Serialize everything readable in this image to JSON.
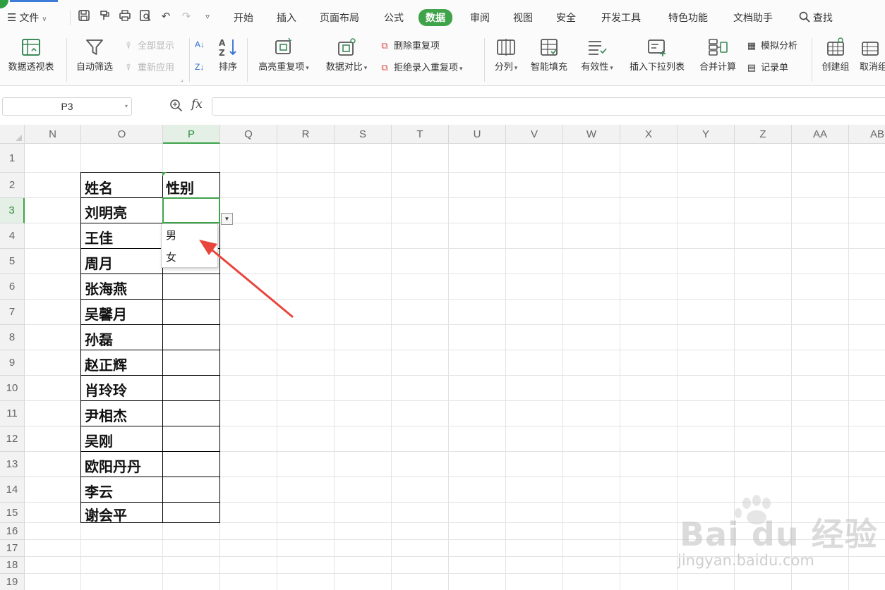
{
  "menubar": {
    "file_label": "文件",
    "tabs": [
      "开始",
      "插入",
      "页面布局",
      "公式",
      "数据",
      "审阅",
      "视图",
      "安全",
      "开发工具",
      "特色功能",
      "文档助手"
    ],
    "active_tab": "数据",
    "search_label": "查找",
    "accent_color": "#3fa34a"
  },
  "ribbon": {
    "pivot_label": "数据透视表",
    "autofilter_label": "自动筛选",
    "show_all_label": "全部显示",
    "reapply_label": "重新应用",
    "sort_label": "排序",
    "highlight_dup_label": "高亮重复项",
    "compare_label": "数据对比",
    "remove_dup_label": "删除重复项",
    "reject_dup_label": "拒绝录入重复项",
    "split_label": "分列",
    "smart_fill_label": "智能填充",
    "validity_label": "有效性",
    "insert_dropdown_label": "插入下拉列表",
    "consolidate_label": "合并计算",
    "simulate_label": "模拟分析",
    "record_label": "记录单",
    "group_label": "创建组",
    "ungroup_label": "取消组"
  },
  "formula_bar": {
    "name_box": "P3",
    "fx_label": "fx",
    "formula": ""
  },
  "sheet": {
    "columns": [
      "N",
      "O",
      "P",
      "Q",
      "R",
      "S",
      "T",
      "U",
      "V",
      "W",
      "X",
      "Y",
      "Z",
      "AA",
      "AB"
    ],
    "selected_column": "P",
    "rows": [
      "1",
      "2",
      "3",
      "4",
      "5",
      "6",
      "7",
      "8",
      "9",
      "10",
      "11",
      "12",
      "13",
      "14",
      "15",
      "16",
      "17",
      "18",
      "19"
    ],
    "selected_row": "3",
    "table": {
      "header": [
        "姓名",
        "性别"
      ],
      "names": [
        "刘明亮",
        "王佳",
        "周月",
        "张海燕",
        "吴馨月",
        "孙磊",
        "赵正辉",
        "肖玲玲",
        "尹相杰",
        "吴刚",
        "欧阳丹丹",
        "李云",
        "谢会平"
      ]
    },
    "dropdown_options": [
      "男",
      "女"
    ]
  },
  "watermark": {
    "brand": "Bai du 经验",
    "url": "jingyan.baidu.com"
  }
}
